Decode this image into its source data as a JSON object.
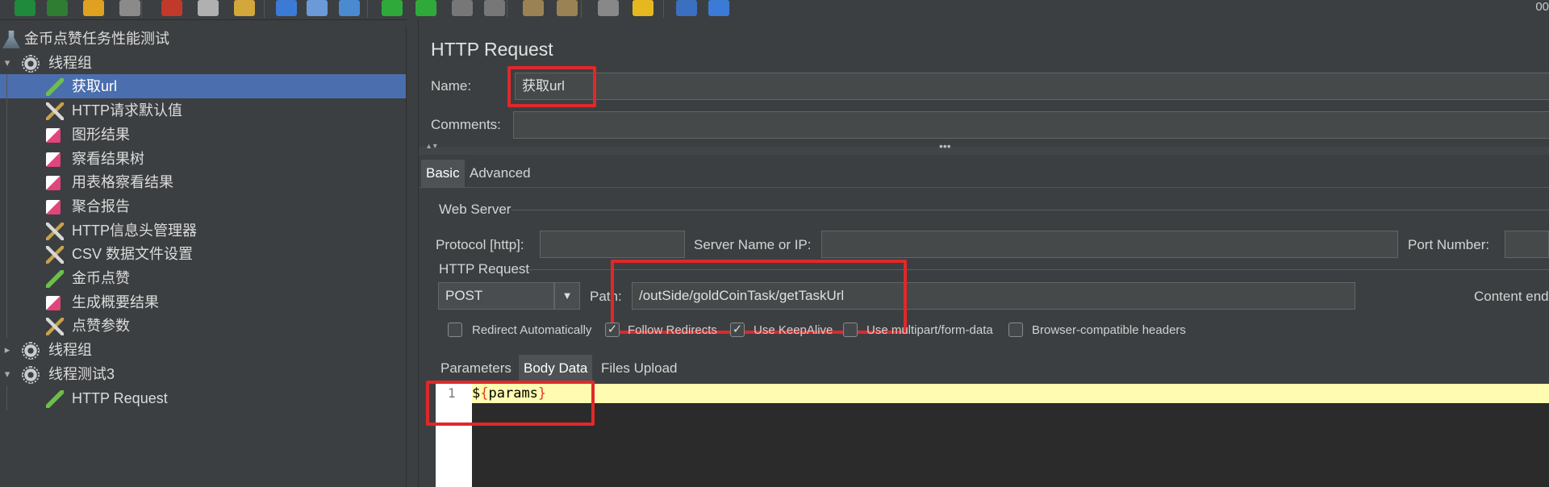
{
  "toolbar": {
    "icons": [
      "new-icon",
      "templates-icon",
      "open-icon",
      "save-icon",
      "cut-icon",
      "copy-icon",
      "paste-icon",
      "expand-icon",
      "collapse-icon",
      "toggle-icon",
      "start-icon",
      "start-no-pause-icon",
      "stop-icon",
      "shutdown-icon",
      "clear-icon",
      "clear-all-icon",
      "search-icon",
      "reset-search-icon",
      "function-helper-icon",
      "help-icon"
    ],
    "clock": "00"
  },
  "tree": {
    "items": [
      {
        "label": "金币点赞任务性能测试",
        "icon": "test-plan-icon",
        "level": 0,
        "arrow": ""
      },
      {
        "label": "线程组",
        "icon": "gear-icon",
        "level": 0,
        "arrow": "▾"
      },
      {
        "label": "获取url",
        "icon": "sampler-icon",
        "level": 1,
        "arrow": "",
        "selected": true
      },
      {
        "label": "HTTP请求默认值",
        "icon": "config-icon",
        "level": 1,
        "arrow": ""
      },
      {
        "label": "图形结果",
        "icon": "listener-icon",
        "level": 1,
        "arrow": ""
      },
      {
        "label": "察看结果树",
        "icon": "listener-icon",
        "level": 1,
        "arrow": ""
      },
      {
        "label": "用表格察看结果",
        "icon": "listener-icon",
        "level": 1,
        "arrow": ""
      },
      {
        "label": "聚合报告",
        "icon": "listener-icon",
        "level": 1,
        "arrow": ""
      },
      {
        "label": "HTTP信息头管理器",
        "icon": "config-icon",
        "level": 1,
        "arrow": ""
      },
      {
        "label": "CSV 数据文件设置",
        "icon": "config-icon",
        "level": 1,
        "arrow": ""
      },
      {
        "label": "金币点赞",
        "icon": "sampler-icon",
        "level": 1,
        "arrow": ""
      },
      {
        "label": "生成概要结果",
        "icon": "listener-icon",
        "level": 1,
        "arrow": ""
      },
      {
        "label": "点赞参数",
        "icon": "config-icon",
        "level": 1,
        "arrow": ""
      },
      {
        "label": "线程组",
        "icon": "gear-icon",
        "level": 0,
        "arrow": "▸"
      },
      {
        "label": "线程测试3",
        "icon": "gear-icon",
        "level": 0,
        "arrow": "▾"
      },
      {
        "label": "HTTP Request",
        "icon": "sampler-icon",
        "level": 1,
        "arrow": ""
      }
    ]
  },
  "panel": {
    "title": "HTTP Request",
    "name_label": "Name:",
    "name_value": "获取url",
    "comments_label": "Comments:",
    "comments_value": "",
    "tabs": [
      "Basic",
      "Advanced"
    ],
    "web_server": {
      "legend": "Web Server",
      "protocol_label": "Protocol [http]:",
      "protocol_value": "",
      "server_label": "Server Name or IP:",
      "server_value": "",
      "port_label": "Port Number:",
      "port_value": ""
    },
    "http_request": {
      "legend": "HTTP Request",
      "method": "POST",
      "path_label": "Path:",
      "path_value": "/outSide/goldCoinTask/getTaskUrl",
      "content_label": "Content end"
    },
    "checkboxes": [
      {
        "label": "Redirect Automatically",
        "checked": false
      },
      {
        "label": "Follow Redirects",
        "checked": true
      },
      {
        "label": "Use KeepAlive",
        "checked": true
      },
      {
        "label": "Use multipart/form-data",
        "checked": false
      },
      {
        "label": "Browser-compatible headers",
        "checked": false
      }
    ],
    "subtabs": [
      "Parameters",
      "Body Data",
      "Files Upload"
    ],
    "editor": {
      "line_number": "1",
      "prefix": "$",
      "open_brace": "{",
      "variable": "params",
      "close_brace": "}"
    }
  }
}
